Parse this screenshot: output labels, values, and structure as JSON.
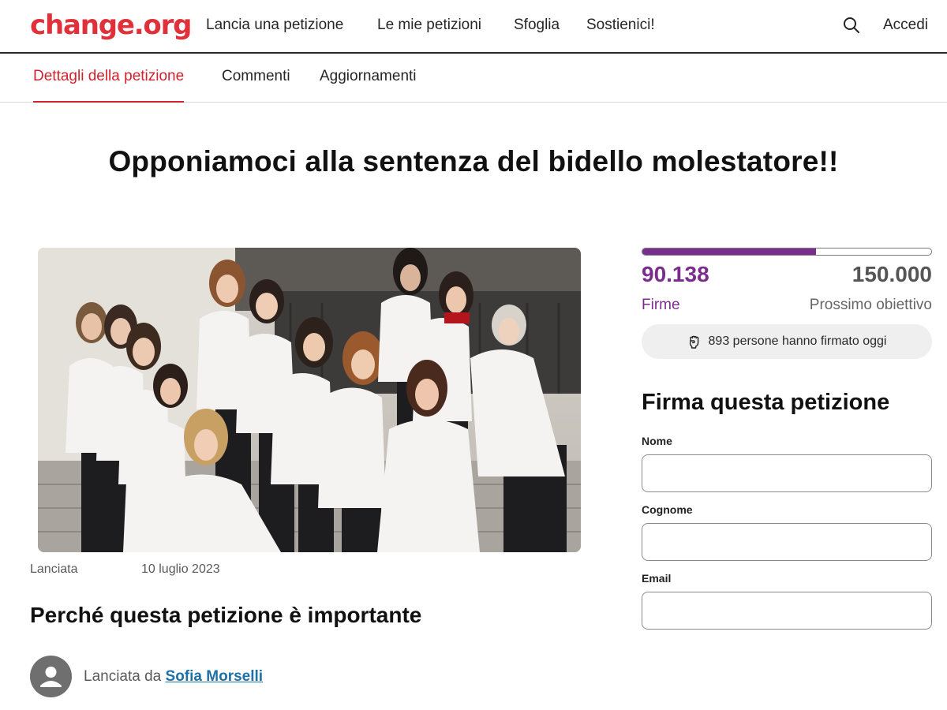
{
  "header": {
    "logo": "change.org",
    "nav": [
      "Lancia una petizione",
      "Le mie petizioni",
      "Sfoglia",
      "Sostienici!"
    ],
    "search_icon": "search-icon",
    "login": "Accedi"
  },
  "tabs": [
    {
      "label": "Dettagli della petizione",
      "active": true
    },
    {
      "label": "Commenti",
      "active": false
    },
    {
      "label": "Aggiornamenti",
      "active": false
    }
  ],
  "petition": {
    "title": "Opponiamoci alla sentenza del bidello molestatore!!",
    "launched_label": "Lanciata",
    "launched_date": "10 luglio 2023",
    "why_heading": "Perché questa petizione è importante",
    "author_prefix": "Lanciata da",
    "author_name": "Sofia Morselli"
  },
  "stats": {
    "progress_fraction": 0.601,
    "signatures": "90.138",
    "signatures_label": "Firme",
    "goal": "150.000",
    "goal_label": "Prossimo obiettivo",
    "today_icon": "raised-fist-icon",
    "today_text": "893 persone hanno firmato oggi"
  },
  "form": {
    "heading": "Firma questa petizione",
    "first_name_label": "Nome",
    "first_name_value": "",
    "last_name_label": "Cognome",
    "last_name_value": "",
    "email_label": "Email",
    "email_value": ""
  },
  "colors": {
    "brand_red": "#e0303a",
    "active_tab": "#d2222d",
    "progress_purple": "#7b2d8e",
    "link_blue": "#1f6fa8"
  }
}
